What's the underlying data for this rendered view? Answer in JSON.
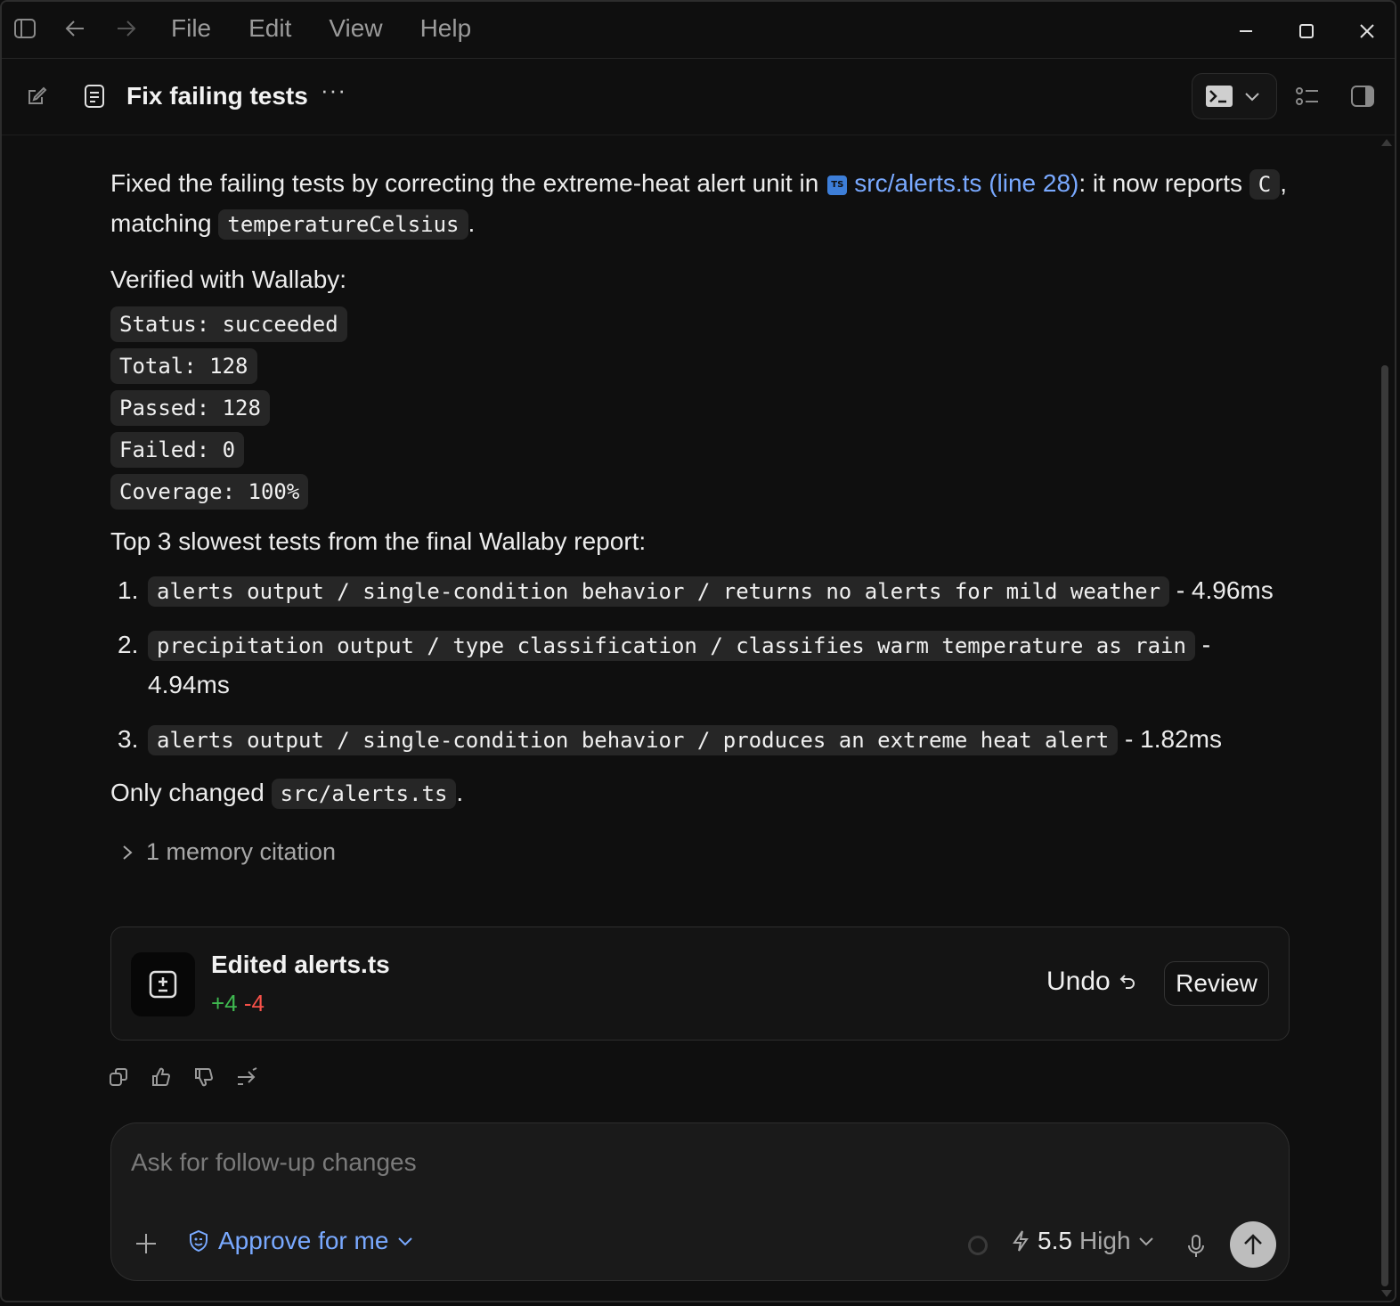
{
  "titlebar": {
    "menu": [
      "File",
      "Edit",
      "View",
      "Help"
    ]
  },
  "header": {
    "title": "Fix failing tests",
    "more": "···"
  },
  "message": {
    "intro_prefix": "Fixed the failing tests by correcting the extreme-heat alert unit in",
    "file_badge": "TS",
    "file_link": "src/alerts.ts (line 28)",
    "intro_mid": ": it now reports",
    "unit_code": "C",
    "intro_mid2": ", matching",
    "var_code": "temperatureCelsius",
    "intro_end": ".",
    "verified": "Verified with Wallaby:",
    "stats": [
      "Status: succeeded",
      "Total: 128",
      "Passed: 128",
      "Failed: 0",
      "Coverage: 100%"
    ],
    "slowest_heading": "Top 3 slowest tests from the final Wallaby report:",
    "slowest": [
      {
        "num": "1.",
        "test": "alerts output / single-condition behavior / returns no alerts for mild weather",
        "time": "- 4.96ms"
      },
      {
        "num": "2.",
        "test": "precipitation output / type classification / classifies warm temperature as rain",
        "time": "- 4.94ms"
      },
      {
        "num": "3.",
        "test": "alerts output / single-condition behavior / produces an extreme heat alert",
        "time": "- 1.82ms"
      }
    ],
    "only_changed_prefix": "Only changed",
    "only_changed_code": "src/alerts.ts",
    "only_changed_end": ".",
    "memory": "1 memory citation"
  },
  "edited_card": {
    "title": "Edited alerts.ts",
    "added": "+4",
    "removed": "-4",
    "undo_label": "Undo",
    "review_label": "Review"
  },
  "composer": {
    "placeholder": "Ask for follow-up changes",
    "approve_label": "Approve for me",
    "model_version": "5.5",
    "model_level": "High"
  },
  "colors": {
    "background": "#0f0f0f",
    "link": "#79a9ff",
    "added": "#3fb950",
    "removed": "#f85149"
  }
}
